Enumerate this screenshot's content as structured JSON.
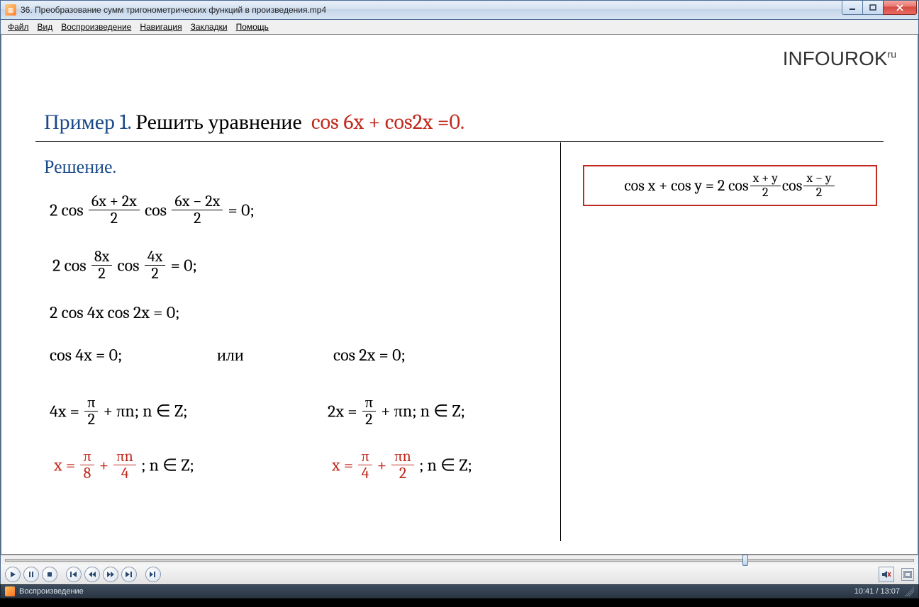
{
  "window": {
    "title": "36. Преобразование сумм тригонометрических функций в произведения.mp4"
  },
  "menu": {
    "items": [
      "Файл",
      "Вид",
      "Воспроизведение",
      "Навигация",
      "Закладки",
      "Помощь"
    ]
  },
  "logo": {
    "main": "INFOUROK",
    "suffix": "ru"
  },
  "slide": {
    "example_label": "Пример 1.",
    "task_label": "Решить уравнение",
    "task_equation": "cos 6x + cos2x =0.",
    "solution_label": "Решение.",
    "lines": {
      "l1_pre": "2 cos",
      "l1_num1": "6x + 2x",
      "l1_den1": "2",
      "l1_mid": "cos",
      "l1_num2": "6x − 2x",
      "l1_den2": "2",
      "l1_post": "= 0;",
      "l2_pre": "2 cos",
      "l2_num1": "8x",
      "l2_den1": "2",
      "l2_mid": "cos",
      "l2_num2": "4x",
      "l2_den2": "2",
      "l2_post": "= 0;",
      "l3": "2 cos 4x cos 2x = 0;",
      "l4a": "cos 4x = 0;",
      "l4_or": "или",
      "l4b": "cos 2x = 0;",
      "l5a_pre": "4x =",
      "l5a_num": "π",
      "l5a_den": "2",
      "l5a_post": "+ πn; n ∈ Z;",
      "l5b_pre": "2x =",
      "l5b_num": "π",
      "l5b_den": "2",
      "l5b_post": "+ πn; n ∈ Z;",
      "l6a_pre": "x =",
      "l6a_num1": "π",
      "l6a_den1": "8",
      "l6a_plus": "+",
      "l6a_num2": "πn",
      "l6a_den2": "4",
      "l6a_post": "; n ∈ Z;",
      "l6b_pre": "x =",
      "l6b_num1": "π",
      "l6b_den1": "4",
      "l6b_plus": "+",
      "l6b_num2": "πn",
      "l6b_den2": "2",
      "l6b_post": "; n ∈ Z;"
    },
    "formula": {
      "pre": "cos x + cos y = 2 cos",
      "num1": "x + y",
      "den1": "2",
      "mid": "cos",
      "num2": "x − y",
      "den2": "2"
    }
  },
  "status": {
    "text": "Воспроизведение",
    "time": "10:41 / 13:07"
  }
}
